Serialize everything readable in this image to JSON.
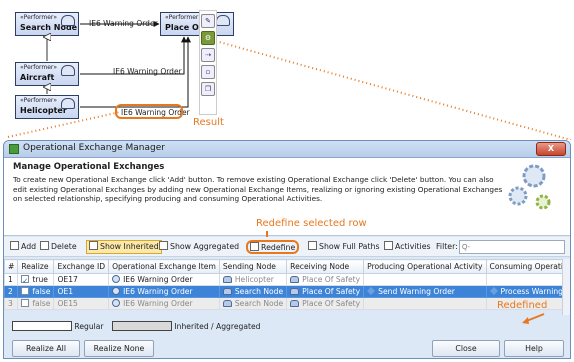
{
  "diagram": {
    "nodes": [
      {
        "stereotype": "«Performer»",
        "name": "Search Node"
      },
      {
        "stereotype": "«Performer»",
        "name": "Place Of S"
      },
      {
        "stereotype": "«Performer»",
        "name": "Aircraft"
      },
      {
        "stereotype": "«Performer»",
        "name": "Helicopter"
      }
    ],
    "flows": [
      {
        "label": "IE6 Warning Order"
      },
      {
        "label": "IE6 Warning Order"
      },
      {
        "label": "IE6 Warning Order"
      }
    ],
    "callouts": {
      "result": "Result",
      "redefine_selected": "Redefine selected row",
      "redefined": "Redefined"
    }
  },
  "dialog": {
    "title": "Operational Exchange Manager",
    "close_label": "X",
    "header": {
      "title": "Manage Operational Exchanges",
      "description": "To create new Operational Exchange click 'Add' button. To remove existing Operational Exchange click 'Delete' button. You can also edit existing Operational Exchanges by adding new Operational Exchange Items, realizing or ignoring existing Operational Exchanges on selected relationship, specifying producing and consuming Operational Activities."
    },
    "toolbar": {
      "add": "Add",
      "delete": "Delete",
      "show_inherited": "Show Inherited",
      "show_aggregated": "Show Aggregated",
      "redefine": "Redefine",
      "show_full_paths": "Show Full Paths",
      "activities": "Activities",
      "filter_label": "Filter:",
      "filter_placeholder": "Q-"
    },
    "table": {
      "columns": [
        "#",
        "Realize",
        "Exchange ID",
        "Operational Exchange Item",
        "Sending Node",
        "Receiving Node",
        "Producing Operational Activity",
        "Consuming Operational Activity"
      ],
      "rows": [
        {
          "num": "1",
          "realize": "true",
          "id": "OE17",
          "item": "IE6 Warning Order",
          "sending": "Helicopter",
          "receiving": "Place Of Safety",
          "producing": "",
          "consuming": ""
        },
        {
          "num": "2",
          "realize": "false",
          "id": "OE1",
          "item": "IE6 Warning Order",
          "sending": "Search Node",
          "receiving": "Place Of Safety",
          "producing": "Send Warning Order",
          "consuming": "Process Warning Order"
        },
        {
          "num": "3",
          "realize": "false",
          "id": "OE15",
          "item": "IE6 Warning Order",
          "sending": "Search Node",
          "receiving": "Place Of Safety",
          "producing": "",
          "consuming": ""
        }
      ]
    },
    "legend": {
      "regular": "Regular",
      "inherited": "Inherited / Aggregated"
    },
    "buttons": {
      "realize_all": "Realize All",
      "realize_none": "Realize None",
      "close": "Close",
      "help": "Help"
    }
  },
  "colors": {
    "accent": "#e8781e",
    "selection": "#3d84d8",
    "inherited_row": "#ececec"
  }
}
